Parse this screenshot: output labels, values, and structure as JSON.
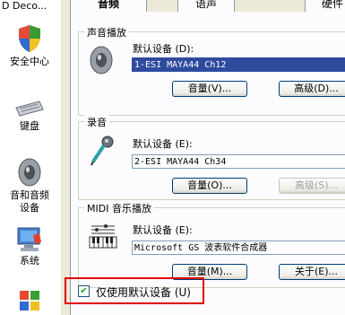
{
  "left_panel": {
    "items": [
      {
        "label": "D Deco..."
      },
      {
        "label": "安全中心"
      },
      {
        "label": "键盘"
      },
      {
        "label": "音和音频\n设备"
      },
      {
        "label": "系统"
      }
    ]
  },
  "tabs": [
    {
      "label": "音频"
    },
    {
      "label": "语声"
    },
    {
      "label": "硬件"
    }
  ],
  "playback": {
    "title": "声音播放",
    "default_label": "默认设备 (D):",
    "device": "1-ESI MAYA44 Ch12",
    "volume_button": "音量(V)...",
    "advanced_button": "高级(D)..."
  },
  "recording": {
    "title": "录音",
    "default_label": "默认设备 (E):",
    "device": "2-ESI MAYA44 Ch34",
    "volume_button": "音量(O)...",
    "advanced_button": "高级(S)..."
  },
  "midi": {
    "title": "MIDI 音乐播放",
    "default_label": "默认设备 (E):",
    "device": "Microsoft GS 波表软件合成器",
    "volume_button": "音量(M)...",
    "about_button": "关于(E)..."
  },
  "use_default_only": {
    "label": "仅使用默认设备 (U)",
    "checked": true,
    "check_glyph": "✔"
  }
}
